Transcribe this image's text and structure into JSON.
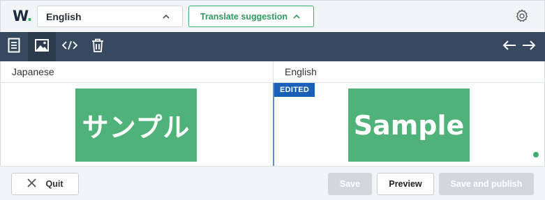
{
  "header": {
    "logo_text": "W",
    "logo_dot": ".",
    "language_select": "English",
    "translate_suggestion_label": "Translate suggestion"
  },
  "toolbar": {
    "buttons": [
      "document-icon",
      "image-icon",
      "code-icon",
      "trash-icon"
    ],
    "active": "image-icon"
  },
  "panes": {
    "left": {
      "language": "Japanese",
      "sample_text": "サンプル"
    },
    "right": {
      "language": "English",
      "sample_text": "Sample",
      "badge": "EDITED"
    }
  },
  "footer": {
    "quit_label": "Quit",
    "save_label": "Save",
    "preview_label": "Preview",
    "publish_label": "Save and publish"
  },
  "colors": {
    "brand_green": "#3fae6d",
    "toolbar_bg": "#36495f",
    "edited_badge": "#1a5fb8",
    "disabled_button": "#d3d7dc"
  }
}
